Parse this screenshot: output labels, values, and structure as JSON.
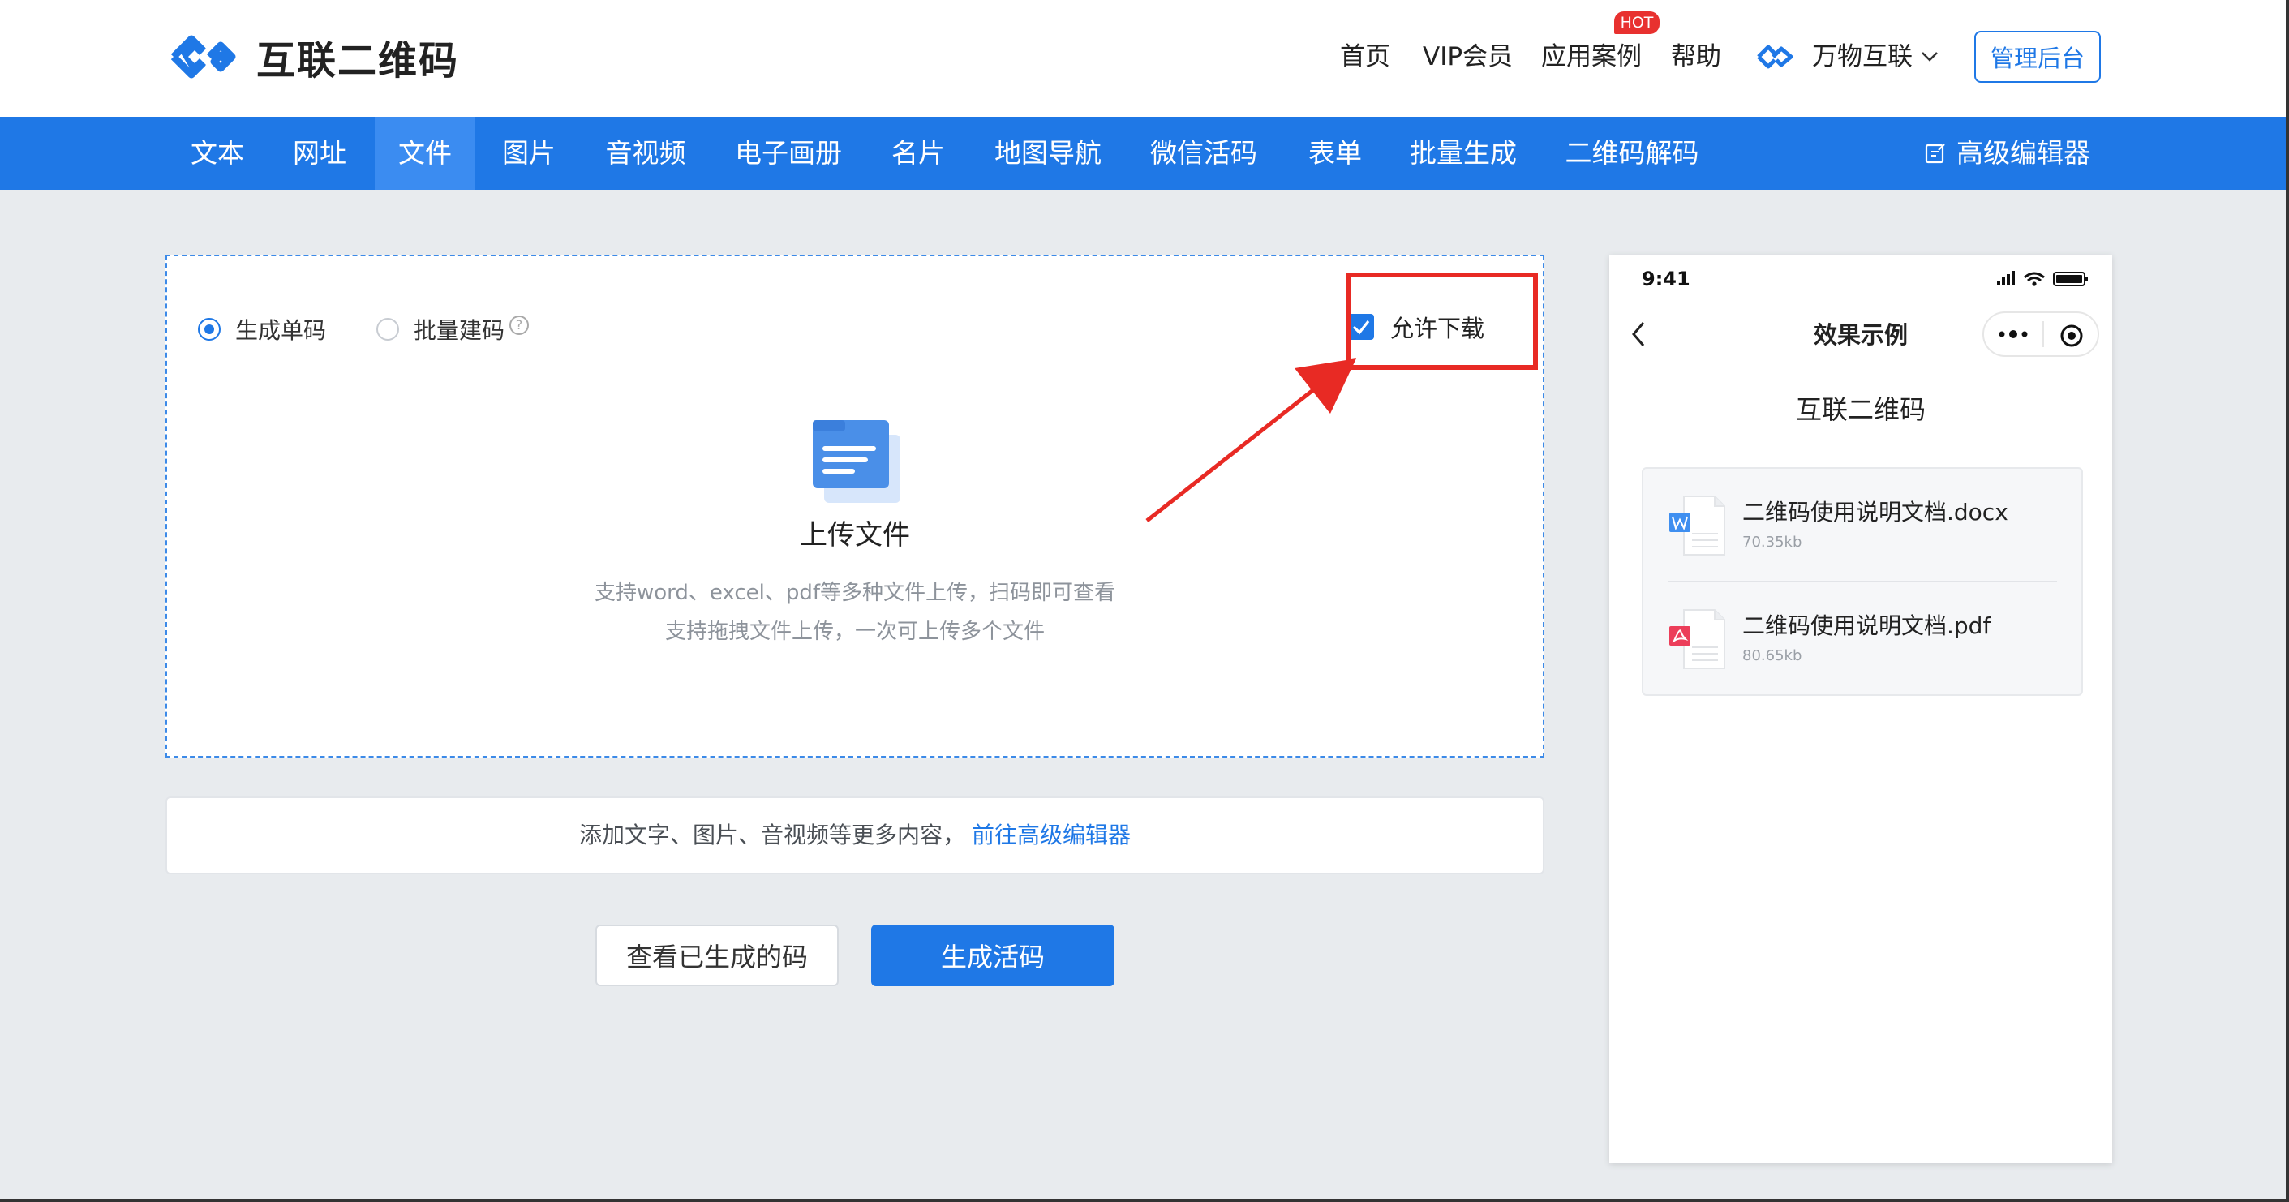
{
  "brand": {
    "name": "互联二维码"
  },
  "top_nav": {
    "home": "首页",
    "vip": "VIP会员",
    "cases": "应用案例",
    "hot_badge": "HOT",
    "help": "帮助",
    "workspace": "万物互联",
    "admin": "管理后台"
  },
  "nav_tabs": [
    "文本",
    "网址",
    "文件",
    "图片",
    "音视频",
    "电子画册",
    "名片",
    "地图导航",
    "微信活码",
    "表单",
    "批量生成",
    "二维码解码"
  ],
  "nav_active": "文件",
  "nav_advanced": "高级编辑器",
  "upload": {
    "mode_single": "生成单码",
    "mode_batch": "批量建码",
    "help_glyph": "?",
    "allow_download": "允许下载",
    "title": "上传文件",
    "desc_line1": "支持word、excel、pdf等多种文件上传，扫码即可查看",
    "desc_line2": "支持拖拽文件上传，一次可上传多个文件"
  },
  "add_bar": {
    "text": "添加文字、图片、音视频等更多内容，",
    "link": "前往高级编辑器"
  },
  "buttons": {
    "view": "查看已生成的码",
    "generate": "生成活码"
  },
  "phone": {
    "time": "9:41",
    "title": "效果示例",
    "brand": "互联二维码",
    "files": [
      {
        "name": "二维码使用说明文档.docx",
        "size": "70.35kb",
        "type": "word-icon"
      },
      {
        "name": "二维码使用说明文档.pdf",
        "size": "80.65kb",
        "type": "pdf-icon"
      }
    ]
  },
  "colors": {
    "primary": "#1f78e6",
    "nav_active": "#3b8cf1",
    "highlight": "#e82a24",
    "hot": "#e8312f",
    "page_bg": "#e8ebee"
  }
}
